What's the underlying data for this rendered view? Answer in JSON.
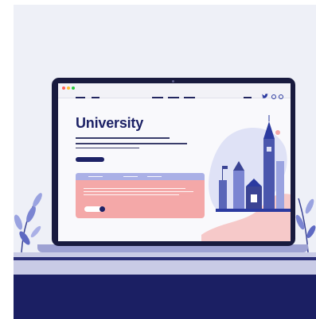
{
  "hero": {
    "title": "University"
  },
  "colors": {
    "navy": "#1d2266",
    "desk": "#1b1f63",
    "card": "#f4a8a8",
    "card_header": "#aab0e6",
    "accent": "#2b3aa0"
  },
  "icons": [
    "window-dot-red-icon",
    "window-dot-yellow-icon",
    "window-dot-green-icon",
    "twitter-icon",
    "search-icon",
    "globe-icon",
    "menu-line-icon"
  ]
}
